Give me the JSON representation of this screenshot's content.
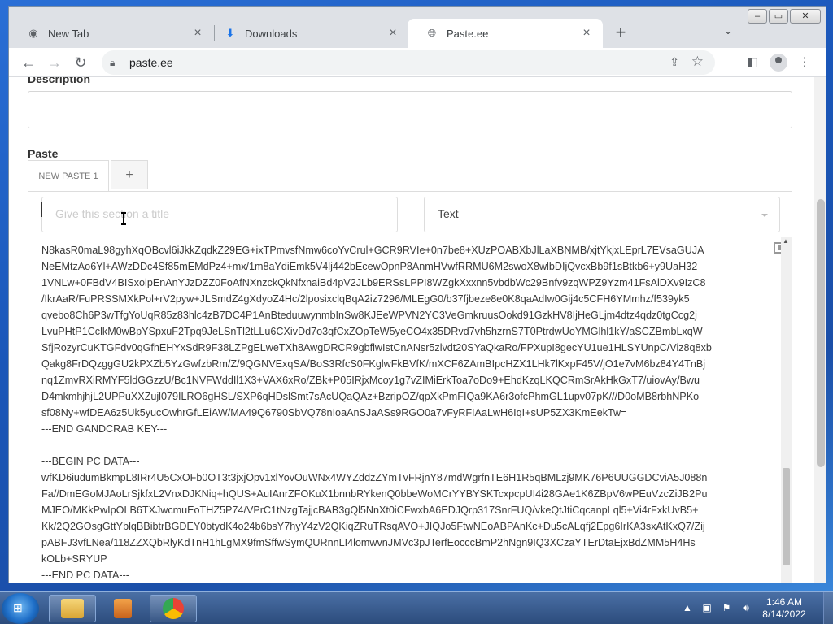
{
  "browser": {
    "tabs": [
      {
        "label": "New Tab",
        "icon": "chrome-icon"
      },
      {
        "label": "Downloads",
        "icon": "download-icon"
      },
      {
        "label": "Paste.ee",
        "icon": "globe-icon",
        "active": true
      }
    ],
    "url": "paste.ee"
  },
  "form": {
    "description_label": "Description",
    "paste_label": "Paste",
    "tab_label": "NEW PASTE 1",
    "add_tab_label": "+",
    "title_placeholder": "Give this section a title",
    "syntax_selected": "Text"
  },
  "editor_lines": [
    "N8kasR0maL98gyhXqOBcvl6iJkkZqdkZ29EG+ixTPmvsfNmw6coYvCrul+GCR9RVIe+0n7be8+XUzPOABXbJlLaXBNMB/xjtYkjxLEprL7EVsaGUJA",
    "NeEMtzAo6Yl+AWzDDc4Sf85mEMdPz4+mx/1m8aYdiEmk5V4lj442bEcewOpnP8AnmHVwfRRMU6M2swoX8wlbDIjQvcxBb9f1sBtkb6+y9UaH32",
    "1VNLw+0FBdV4BISxolpEnAnYJzDZZ0FoAfNXnzckQkNfxnaiBd4pV2JLb9ERSsLPPI8WZgkXxxnn5vbdbWc29Bnfv9zqWPZ9Yzm41FsAlDXv9IzC8",
    "/IkrAaR/FuPRSSMXkPol+rV2pyw+JLSmdZ4gXdyoZ4Hc/2lposixclqBqA2iz7296/MLEgG0/b37fjbeze8e0K8qaAdIw0Gij4c5CFH6YMmhz/f539yk5",
    "qvebo8Ch6P3wTfgYoUqR85z83hlc4zB7DC4P1AnBteduuwynmbInSw8KJEeWPVN2YC3VeGmkruusOokd91GzkHV8IjHeGLjm4dtz4qdz0tgCcg2j",
    "LvuPHtP1CclkM0wBpYSpxuF2Tpq9JeLSnTl2tLLu6CXivDd7o3qfCxZOpTeW5yeCO4x35DRvd7vh5hzrnS7T0PtrdwUoYMGlhl1kY/aSCZBmbLxqW",
    "SfjRozyrCuKTGFdv0qGfhEHYxSdR9F38LZPgELweTXh8AwgDRCR9gbflwIstCnANsr5zlvdt20SYaQkaRo/FPXupI8gecYU1ue1HLSYUnpC/Viz8q8xb",
    "Qakg8FrDQzggGU2kPXZb5YzGwfzbRm/Z/9QGNVExqSA/BoS3RfcS0FKglwFkBVfK/mXCF6ZAmBIpcHZX1LHk7lKxpF45V/jO1e7vM6bz84Y4TnBj",
    "nq1ZmvRXiRMYF5ldGGzzU/Bc1NVFWddIl1X3+VAX6xRo/ZBk+P05IRjxMcoy1g7vZIMiErkToa7oDo9+EhdKzqLKQCRmSrAkHkGxT7/uiovAy/Bwu",
    "D4mkmhjhjL2UPPuXXZujl079ILRO6gHSL/SXP6qHDslSmt7sAcUQaQAz+BzripOZ/qpXkPmFIQa9KA6r3ofcPhmGL1upv07pK///D0oMB8rbhNPKo",
    "sf08Ny+wfDEA6z5Uk5yucOwhrGfLEiAW/MA49Q6790SbVQ78nIoaAnSJaASs9RGO0a7vFyRFIAaLwH6IqI+sUP5ZX3KmEekTw=",
    "---END GANDCRAB KEY---",
    "",
    "---BEGIN PC DATA---",
    "wfKD6iudumBkmpL8IRr4U5CxOFb0OT3t3jxjOpv1xlYovOuWNx4WYZddzZYmTvFRjnY87mdWgrfnTE6H1R5qBMLzj9MK76P6UUGGDCviA5J088n",
    "Fa//DmEGoMJAoLrSjkfxL2VnxDJKNiq+hQUS+AuIAnrZFOKuX1bnnbRYkenQ0bbeWoMCrYYBYSKTcxpcpUI4i28GAe1K6ZBpV6wPEuVzcZiJB2Pu",
    "MJEO/MKkPwIpOLB6TXJwcmuEoTHZ5P74/VPrC1tNzgTajjcBAB3gQl5NnXt0iCFwxbA6EDJQrp317SnrFUQ/vkeQtJtiCqcanpLql5+Vi4rFxkUvB5+",
    "Kk/2Q2GOsgGttYblqBBibtrBGDEY0btydK4o24b6bsY7hyY4zV2QKiqZRuTRsqAVO+JIQJo5FtwNEoABPAnKc+Du5cALqfj2Epg6IrKA3sxAtKxQ7/Zij",
    "pABFJ3vfLNea/118ZZXQbRlyKdTnH1hLgMX9fmSffwSymQURnnLI4lomwvnJMVc3pJTerfEocccBmP2hNgn9IQ3XCzaYTErDtaEjxBdZMM5H4Hs",
    "kOLb+SRYUP",
    "---END PC DATA---"
  ],
  "taskbar": {
    "time": "1:46 AM",
    "date": "8/14/2022"
  }
}
